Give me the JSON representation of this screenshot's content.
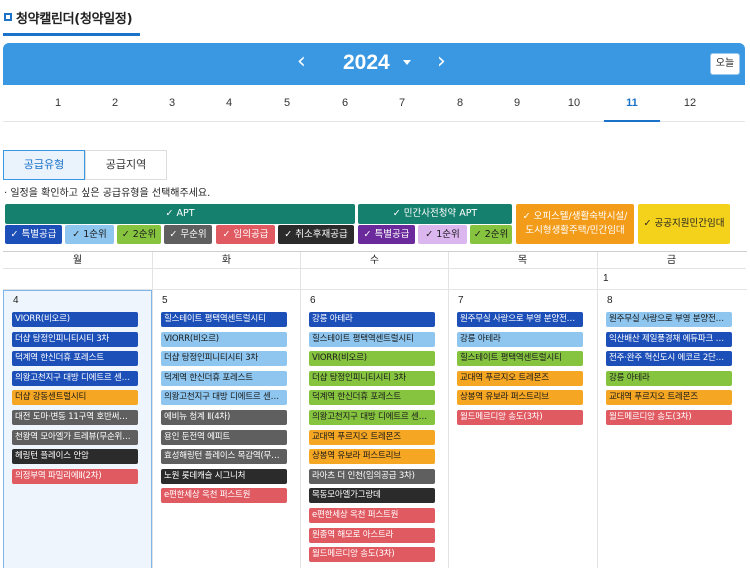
{
  "header": {
    "title": "청약캘린더(청약일정)"
  },
  "year_bar": {
    "prev": "‹",
    "year": "2024",
    "next": "›",
    "today_label": "오늘"
  },
  "months": [
    "1",
    "2",
    "3",
    "4",
    "5",
    "6",
    "7",
    "8",
    "9",
    "10",
    "11",
    "12"
  ],
  "active_month": "11",
  "tabs": [
    {
      "label": "공급유형",
      "active": true
    },
    {
      "label": "공급지역",
      "active": false
    }
  ],
  "hint": "· 일정을 확인하고 싶은 공급유형을 선택해주세요.",
  "categories": {
    "apt": "✓ APT",
    "private": "✓ 민간사전청약 APT",
    "office_line1": "✓ 오피스텔/생활숙박시설/",
    "office_line2": "도시형생활주택/민간임대",
    "public": "✓ 공공지원민간임대"
  },
  "chips": [
    {
      "label": "✓ 특별공급",
      "bg": "#1d4fb8",
      "fg": "#ffffff"
    },
    {
      "label": "✓ 1순위",
      "bg": "#8ec6ef",
      "fg": "#1a1a1a"
    },
    {
      "label": "✓ 2순위",
      "bg": "#86c440",
      "fg": "#1a1a1a"
    },
    {
      "label": "✓ 무순위",
      "bg": "#5f5f5f",
      "fg": "#ffffff"
    },
    {
      "label": "✓ 임의공급",
      "bg": "#e05a62",
      "fg": "#ffffff"
    },
    {
      "label": "✓ 취소후재공급",
      "bg": "#2b2b2b",
      "fg": "#ffffff"
    },
    {
      "label": "✓ 특별공급",
      "bg": "#6b2a9c",
      "fg": "#ffffff"
    },
    {
      "label": "✓ 1순위",
      "bg": "#dcb6ef",
      "fg": "#1a1a1a"
    },
    {
      "label": "✓ 2순위",
      "bg": "#86c440",
      "fg": "#1a1a1a"
    }
  ],
  "calendar": {
    "weekdays": [
      "월",
      "화",
      "수",
      "목",
      "금"
    ],
    "first_row_dates": [
      "",
      "",
      "",
      "",
      "1"
    ],
    "week_dates": [
      "4",
      "5",
      "6",
      "7",
      "8"
    ],
    "colors": {
      "blue": "#1d4fb8",
      "light": "#8ec6ef",
      "green": "#86c440",
      "orange": "#f5a623",
      "gray": "#5f5f5f",
      "dark": "#2b2b2b",
      "red": "#e05a62"
    },
    "events": [
      [
        {
          "t": "VIORR(비오르)",
          "c": "blue"
        },
        {
          "t": "더샵 탕정인피니티시티 3차",
          "c": "blue"
        },
        {
          "t": "덕계역 한신더휴 포레스트",
          "c": "blue"
        },
        {
          "t": "의왕고천지구 대방 디에트르 센…",
          "c": "blue"
        },
        {
          "t": "더샵 강동센트럴시티",
          "c": "orange"
        },
        {
          "t": "대전 도마·변동 11구역 호반써…",
          "c": "gray"
        },
        {
          "t": "천왕역 모아엘가 트레뷰(무순위…",
          "c": "gray"
        },
        {
          "t": "헤링턴 플레이스 안암",
          "c": "dark"
        },
        {
          "t": "의정부역 파밀리에Ⅱ(2차)",
          "c": "red"
        }
      ],
      [
        {
          "t": "힐스테이트 평택역센트럴시티",
          "c": "blue"
        },
        {
          "t": "VIORR(비오르)",
          "c": "light"
        },
        {
          "t": "더샵 탕정인피니티시티 3차",
          "c": "light"
        },
        {
          "t": "덕계역 한신더휴 포레스트",
          "c": "light"
        },
        {
          "t": "의왕고천지구 대방 디에트르 센…",
          "c": "light"
        },
        {
          "t": "에비뉴 청계 Ⅱ(4차)",
          "c": "gray"
        },
        {
          "t": "용인 둔전역 에피트",
          "c": "gray"
        },
        {
          "t": "효성해링턴 플레이스 목감역(무…",
          "c": "gray"
        },
        {
          "t": "노원 롯데캐슬 시그니처",
          "c": "dark"
        },
        {
          "t": "e편한세상 옥천 퍼스트원",
          "c": "red"
        }
      ],
      [
        {
          "t": "강릉 아테라",
          "c": "blue"
        },
        {
          "t": "힐스테이트 평택역센트럴시티",
          "c": "light"
        },
        {
          "t": "VIORR(비오르)",
          "c": "green"
        },
        {
          "t": "더샵 탕정인피니티시티 3차",
          "c": "green"
        },
        {
          "t": "덕계역 한신더휴 포레스트",
          "c": "green"
        },
        {
          "t": "의왕고천지구 대방 디에트르 센…",
          "c": "green"
        },
        {
          "t": "교대역 푸르지오 트레몬즈",
          "c": "orange"
        },
        {
          "t": "상봉역 유보라 퍼스트리브",
          "c": "orange"
        },
        {
          "t": "라아츠 더 인천(임의공급 3차)",
          "c": "gray"
        },
        {
          "t": "목동모아엘가그랑데",
          "c": "dark"
        },
        {
          "t": "e편한세상 옥천 퍼스트원",
          "c": "red"
        },
        {
          "t": "원종역 해모로 아스트라",
          "c": "red"
        },
        {
          "t": "월드메르디앙 송도(3차)",
          "c": "red"
        }
      ],
      [
        {
          "t": "원주무실 사랑으로 부영 분양전…",
          "c": "blue"
        },
        {
          "t": "강릉 아테라",
          "c": "light"
        },
        {
          "t": "힐스테이트 평택역센트럴시티",
          "c": "green"
        },
        {
          "t": "교대역 푸르지오 트레몬즈",
          "c": "orange"
        },
        {
          "t": "상봉역 유보라 퍼스트리브",
          "c": "orange"
        },
        {
          "t": "월드메르디앙 송도(3차)",
          "c": "red"
        }
      ],
      [
        {
          "t": "원주무실 사랑으로 부영 분양전…",
          "c": "light"
        },
        {
          "t": "익산배산 제일풍경채 에듀파크 …",
          "c": "blue"
        },
        {
          "t": "전주·완주 혁신도시 에코르 2단…",
          "c": "blue"
        },
        {
          "t": "강릉 아테라",
          "c": "green"
        },
        {
          "t": "교대역 푸르지오 트레몬즈",
          "c": "orange"
        },
        {
          "t": "월드메르디앙 송도(3차)",
          "c": "red"
        }
      ]
    ]
  }
}
